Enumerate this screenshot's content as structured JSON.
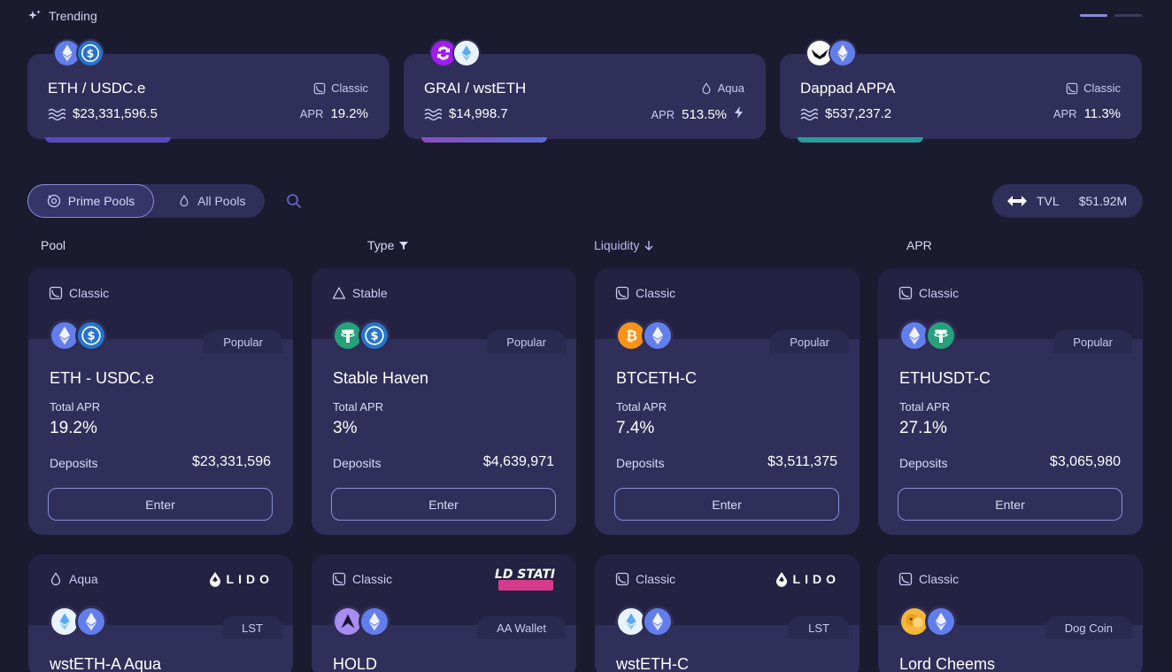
{
  "trending": {
    "label": "Trending",
    "cards": [
      {
        "name": "ETH / USDC.e",
        "type": "Classic",
        "tvl": "$23,331,596.5",
        "apr_label": "APR",
        "apr": "19.2%"
      },
      {
        "name": "GRAI / wstETH",
        "type": "Aqua",
        "tvl": "$14,998.7",
        "apr_label": "APR",
        "apr": "513.5%"
      },
      {
        "name": "Dappad APPA",
        "type": "Classic",
        "tvl": "$537,237.2",
        "apr_label": "APR",
        "apr": "11.3%"
      }
    ]
  },
  "filters": {
    "prime": "Prime Pools",
    "all": "All Pools"
  },
  "tvl": {
    "label": "TVL",
    "value": "$51.92M"
  },
  "columns": {
    "pool": "Pool",
    "type": "Type",
    "liquidity": "Liquidity",
    "apr": "APR"
  },
  "pools": [
    {
      "type": "Classic",
      "tag": "Popular",
      "name": "ETH - USDC.e",
      "apr_label": "Total APR",
      "apr": "19.2%",
      "dep_label": "Deposits",
      "deposits": "$23,331,596",
      "enter": "Enter"
    },
    {
      "type": "Stable",
      "tag": "Popular",
      "name": "Stable Haven",
      "apr_label": "Total APR",
      "apr": "3%",
      "dep_label": "Deposits",
      "deposits": "$4,639,971",
      "enter": "Enter"
    },
    {
      "type": "Classic",
      "tag": "Popular",
      "name": "BTCETH-C",
      "apr_label": "Total APR",
      "apr": "7.4%",
      "dep_label": "Deposits",
      "deposits": "$3,511,375",
      "enter": "Enter"
    },
    {
      "type": "Classic",
      "tag": "Popular",
      "name": "ETHUSDT-C",
      "apr_label": "Total APR",
      "apr": "27.1%",
      "dep_label": "Deposits",
      "deposits": "$3,065,980",
      "enter": "Enter"
    },
    {
      "type": "Aqua",
      "tag": "LST",
      "name": "wstETH-A Aqua",
      "brand": "LIDO"
    },
    {
      "type": "Classic",
      "tag": "AA Wallet",
      "name": "HOLD",
      "brand": "HOLD STATION"
    },
    {
      "type": "Classic",
      "tag": "LST",
      "name": "wstETH-C",
      "brand": "LIDO"
    },
    {
      "type": "Classic",
      "tag": "Dog Coin",
      "name": "Lord Cheems"
    }
  ],
  "colors": {
    "bg": "#1b1b2f",
    "card": "#302f5a",
    "accent": "#8a8cd9",
    "eth": "#627eea",
    "usdc": "#2775ca",
    "usdt": "#26a17b",
    "btc": "#f7931a"
  }
}
